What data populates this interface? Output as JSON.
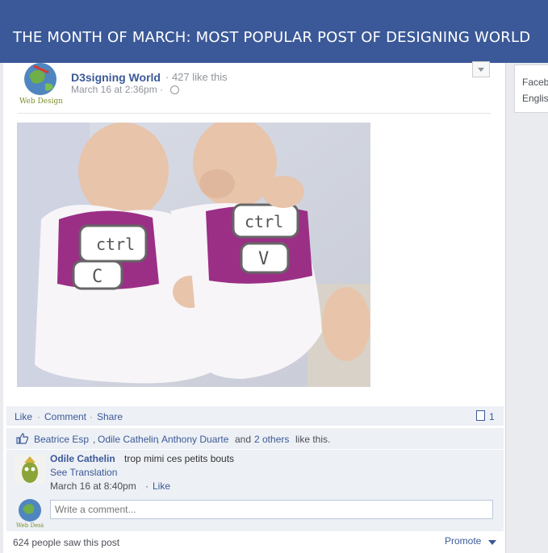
{
  "banner": {
    "title": "THE MONTH OF MARCH: MOST POPULAR POST OF DESIGNING WORLD"
  },
  "post": {
    "page_name": "D3signing World",
    "likes_text": "· 427 like this",
    "date": "March 16 at 2:36pm ·",
    "avatar_label": "Web Design"
  },
  "photo": {
    "left_onesie": {
      "key_top": "ctrl",
      "key_bottom": "C"
    },
    "right_onesie": {
      "key_top": "ctrl",
      "key_bottom": "V"
    }
  },
  "actions": {
    "like": "Like",
    "comment": "Comment",
    "share": "Share",
    "sep": "·",
    "comment_count": "1"
  },
  "likes_line": {
    "names": [
      "Beatrice Esp",
      "Odile Cathelin",
      "Anthony Duarte"
    ],
    "comma": ",",
    "and_text": "and",
    "others": "2 others",
    "suffix": "like this."
  },
  "comment": {
    "author": "Odile Cathelin",
    "text": "trop mimi ces petits bouts",
    "translate": "See Translation",
    "date": "March 16 at 8:40pm",
    "sep": "·",
    "like": "Like"
  },
  "composer": {
    "placeholder": "Write a comment..."
  },
  "footer": {
    "seen": "624 people saw this post",
    "promote": "Promote"
  },
  "sidebar": {
    "line1": "Faceb",
    "line2": "Englis"
  },
  "colors": {
    "brand": "#3b5998",
    "ufi_bg": "#edf0f5",
    "onesie_print": "#9b2f86"
  }
}
